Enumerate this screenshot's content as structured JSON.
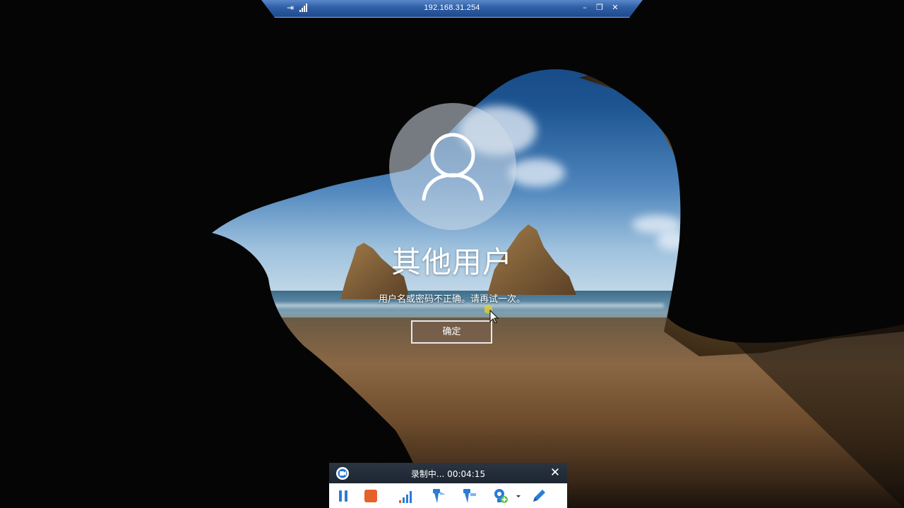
{
  "remote_bar": {
    "title": "192.168.31.254",
    "pin_icon": "pin-icon",
    "signal_icon": "signal-icon",
    "minimize_glyph": "–",
    "restore_glyph": "❐",
    "close_glyph": "✕"
  },
  "login": {
    "username": "其他用户",
    "message": "用户名或密码不正确。请再试一次。",
    "ok_label": "确定"
  },
  "recorder": {
    "status": "录制中... 00:04:15",
    "close_glyph": "✕",
    "tools": [
      "pause-icon",
      "stop-icon",
      "signal-bars-icon",
      "pin-marker-icon",
      "pin-marker-alt-icon",
      "add-webcam-icon",
      "dropdown-arrow-icon",
      "pen-icon"
    ]
  },
  "colors": {
    "rdp_bar": "#2f5ea6",
    "ok_border": "#e8e8e8",
    "stop_red": "#e5622c",
    "tool_blue": "#2c7bd6",
    "recorder_header": "#1d2631"
  }
}
